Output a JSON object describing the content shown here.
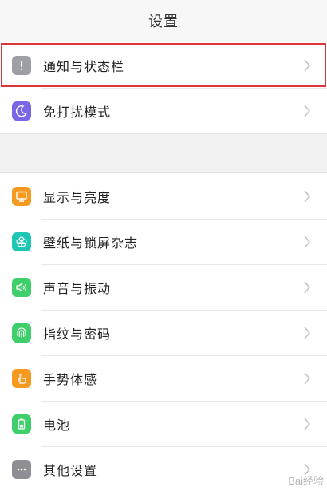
{
  "header": {
    "title": "设置"
  },
  "groups": [
    {
      "items": [
        {
          "label": "通知与状态栏",
          "icon": "notification-icon",
          "color": "#9e9ea6"
        },
        {
          "label": "免打扰模式",
          "icon": "moon-icon",
          "color": "#7a67e8"
        }
      ]
    },
    {
      "items": [
        {
          "label": "显示与亮度",
          "icon": "display-icon",
          "color": "#f59a1f"
        },
        {
          "label": "壁纸与锁屏杂志",
          "icon": "flower-icon",
          "color": "#1ec6b4"
        },
        {
          "label": "声音与振动",
          "icon": "speaker-icon",
          "color": "#3fcf6a"
        },
        {
          "label": "指纹与密码",
          "icon": "fingerprint-icon",
          "color": "#3fcf6a"
        },
        {
          "label": "手势体感",
          "icon": "hand-icon",
          "color": "#f59a1f"
        },
        {
          "label": "电池",
          "icon": "battery-icon",
          "color": "#3fcf6a"
        },
        {
          "label": "其他设置",
          "icon": "more-icon",
          "color": "#8e8e94"
        }
      ]
    }
  ],
  "watermark": "Bai经验"
}
